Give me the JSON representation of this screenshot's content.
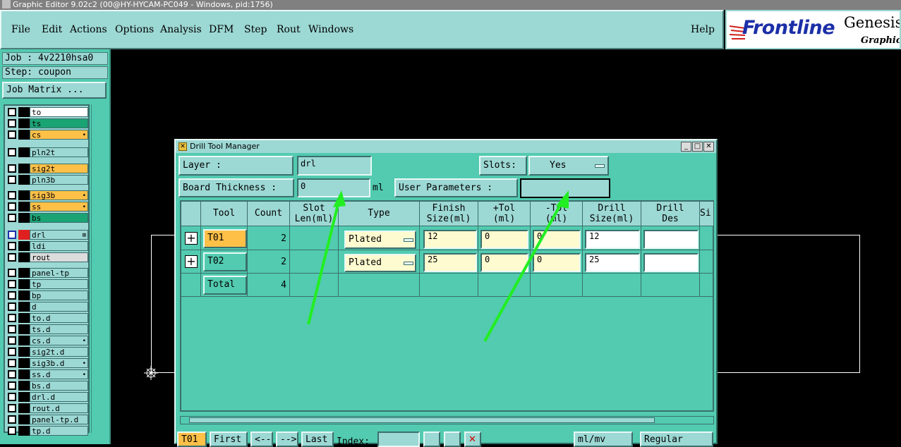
{
  "window_title": "Graphic Editor 9.02c2 (00@HY-HYCAM-PC049 - Windows, pid:1756)",
  "menu": [
    "File",
    "Edit",
    "Actions",
    "Options",
    "Analysis",
    "DFM",
    "Step",
    "Rout",
    "Windows"
  ],
  "help": "Help",
  "logo": {
    "brand": "Frontline",
    "product": "Genesis",
    "sub": "Graphic E"
  },
  "job": "Job : 4v2210hsa0",
  "step": "Step: coupon",
  "job_matrix": "Job Matrix ...",
  "layers": [
    {
      "name": "to",
      "color": "#ffffff",
      "flag": ""
    },
    {
      "name": "ts",
      "color": "#1aa373",
      "flag": ""
    },
    {
      "name": "cs",
      "color": "#ffc048",
      "flag": "•"
    },
    {
      "name": "pln2t",
      "color": "#9cd8d4",
      "flag": ""
    },
    {
      "name": "sig2t",
      "color": "#ffc048",
      "flag": ""
    },
    {
      "name": "pln3b",
      "color": "#9cd8d4",
      "flag": ""
    },
    {
      "name": "sig3b",
      "color": "#ffc048",
      "flag": "•"
    },
    {
      "name": "ss",
      "color": "#ffc048",
      "flag": "•"
    },
    {
      "name": "bs",
      "color": "#1aa373",
      "flag": ""
    },
    {
      "name": "drl",
      "color": "#9cd8d4",
      "flag": "⊞"
    },
    {
      "name": "ldi",
      "color": "#9cd8d4",
      "flag": ""
    },
    {
      "name": "rout",
      "color": "#dcdcdc",
      "flag": ""
    },
    {
      "name": "panel-tp",
      "color": "#9cd8d4",
      "flag": ""
    },
    {
      "name": "tp",
      "color": "#9cd8d4",
      "flag": ""
    },
    {
      "name": "bp",
      "color": "#9cd8d4",
      "flag": ""
    },
    {
      "name": "d",
      "color": "#9cd8d4",
      "flag": ""
    },
    {
      "name": "to.d",
      "color": "#9cd8d4",
      "flag": ""
    },
    {
      "name": "ts.d",
      "color": "#9cd8d4",
      "flag": ""
    },
    {
      "name": "cs.d",
      "color": "#9cd8d4",
      "flag": "•"
    },
    {
      "name": "sig2t.d",
      "color": "#9cd8d4",
      "flag": ""
    },
    {
      "name": "sig3b.d",
      "color": "#9cd8d4",
      "flag": "•"
    },
    {
      "name": "ss.d",
      "color": "#9cd8d4",
      "flag": "•"
    },
    {
      "name": "bs.d",
      "color": "#9cd8d4",
      "flag": ""
    },
    {
      "name": "drl.d",
      "color": "#9cd8d4",
      "flag": ""
    },
    {
      "name": "rout.d",
      "color": "#9cd8d4",
      "flag": ""
    },
    {
      "name": "panel-tp.d",
      "color": "#9cd8d4",
      "flag": ""
    },
    {
      "name": "tp.d",
      "color": "#9cd8d4",
      "flag": ""
    }
  ],
  "dialog": {
    "title": "Drill Tool Manager",
    "layer_label": "Layer :",
    "layer_value": "drl",
    "slots_label": "Slots:",
    "slots_value": "Yes",
    "board_label": "Board Thickness :",
    "board_value": "0",
    "board_unit": "ml",
    "user_params": "User Parameters :",
    "user_params_value": "",
    "headers": [
      "Tool",
      "Count",
      "Slot\nLen(ml)",
      "Type",
      "Finish\nSize(ml)",
      "+Tol\n(ml)",
      "-Tol\n(ml)",
      "Drill\nSize(ml)",
      "Drill\nDes",
      "Si"
    ],
    "rows": [
      {
        "tool": "T01",
        "count": "2",
        "type": "Plated",
        "finish": "12",
        "ptol": "0",
        "mtol": "0",
        "drill": "12",
        "des": ""
      },
      {
        "tool": "T02",
        "count": "2",
        "type": "Plated",
        "finish": "25",
        "ptol": "0",
        "mtol": "0",
        "drill": "25",
        "des": ""
      }
    ],
    "total_label": "Total",
    "total_count": "4",
    "bottom": {
      "current": "T01",
      "first": "First",
      "prev": "<--",
      "next": "-->",
      "last": "Last",
      "index_label": "Index:",
      "units": "ml/mv",
      "mode": "Regular"
    }
  }
}
